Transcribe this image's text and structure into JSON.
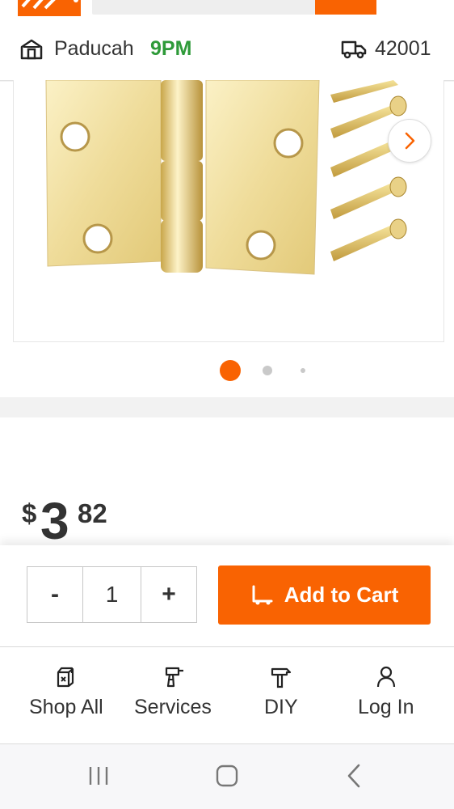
{
  "header": {
    "logo_icon": "home-depot-logo",
    "search_placeholder": "",
    "cart_icon": "cart-icon"
  },
  "location": {
    "store_name": "Paducah",
    "store_hours": "9PM",
    "zip": "42001",
    "hours_color": "#2e9a39"
  },
  "gallery": {
    "image_alt": "Brass door hinge with screws",
    "dot_count": 3,
    "active_dot": 0
  },
  "price": {
    "dollar_sign": "$",
    "whole": "3",
    "cents": "82"
  },
  "cart": {
    "minus_label": "-",
    "quantity": "1",
    "plus_label": "+",
    "add_to_cart_label": "Add to Cart"
  },
  "bottom_nav": {
    "items": [
      {
        "label": "Shop All",
        "icon": "shop-all-icon"
      },
      {
        "label": "Services",
        "icon": "drill-icon"
      },
      {
        "label": "DIY",
        "icon": "hammer-icon"
      },
      {
        "label": "Log In",
        "icon": "user-icon"
      }
    ]
  },
  "colors": {
    "brand_orange": "#f96302",
    "text_dark": "#333333"
  }
}
